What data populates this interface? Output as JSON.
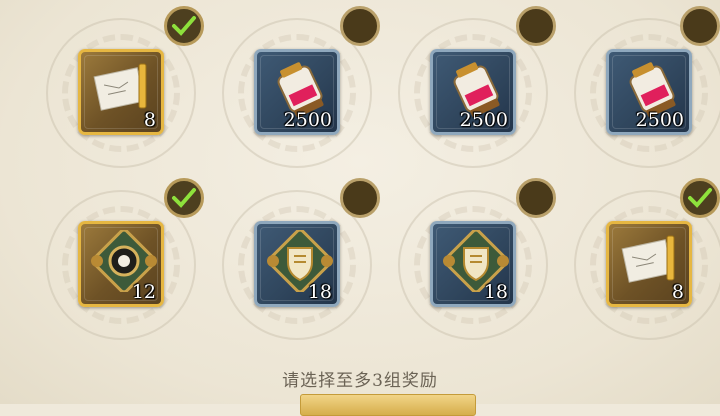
{
  "hint_text": "请选择至多3组奖励",
  "rewards": [
    {
      "item": "blueprint-scroll-icon",
      "rarity": "gold",
      "count": "8",
      "selected": true
    },
    {
      "item": "potion-canister-icon",
      "rarity": "blue",
      "count": "2500",
      "selected": false
    },
    {
      "item": "potion-canister-icon",
      "rarity": "blue",
      "count": "2500",
      "selected": false
    },
    {
      "item": "potion-canister-icon",
      "rarity": "blue",
      "count": "2500",
      "selected": false
    },
    {
      "item": "gear-emblem-icon",
      "rarity": "gold",
      "count": "12",
      "selected": true
    },
    {
      "item": "shield-emblem-icon",
      "rarity": "blue",
      "count": "18",
      "selected": false
    },
    {
      "item": "shield-emblem-icon",
      "rarity": "blue",
      "count": "18",
      "selected": false
    },
    {
      "item": "blueprint-scroll-icon",
      "rarity": "gold",
      "count": "8",
      "selected": true
    }
  ],
  "colors": {
    "gold_border": "#e6b742",
    "blue_border": "#8fa8bd",
    "check_green": "#8ee13c"
  }
}
